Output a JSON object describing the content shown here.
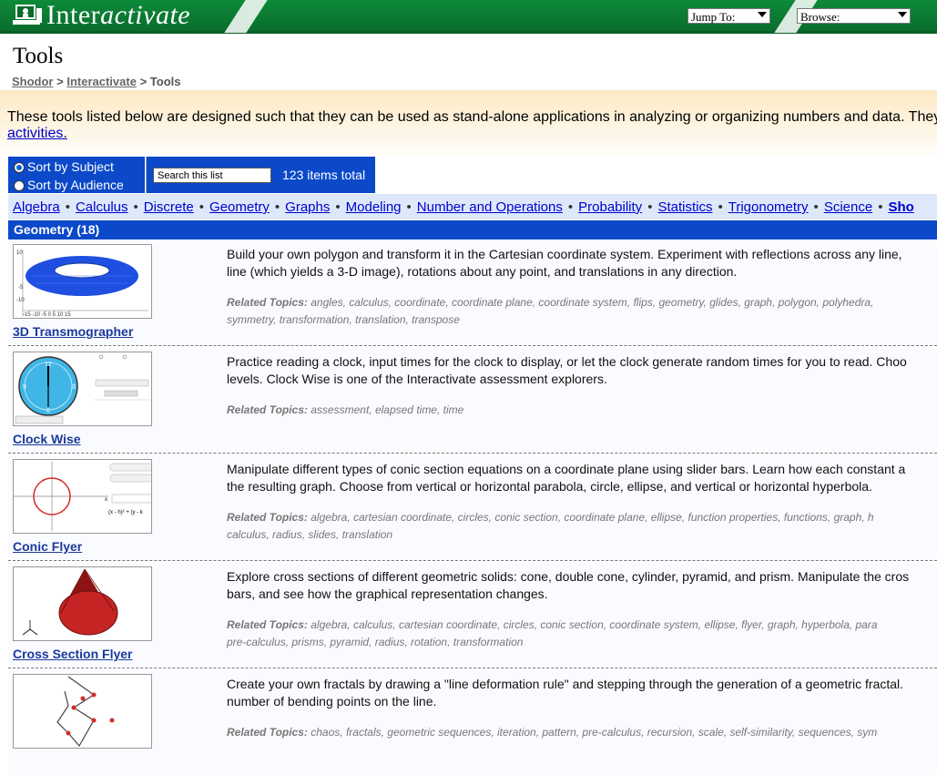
{
  "header": {
    "logo_text_bold": "Inter",
    "logo_text_italic": "activate",
    "jump_label": "Jump To:",
    "browse_label": "Browse:"
  },
  "page": {
    "title": "Tools",
    "breadcrumb": [
      {
        "label": "Shodor",
        "link": true
      },
      {
        "label": "Interactivate",
        "link": true
      },
      {
        "label": "Tools",
        "link": false
      }
    ],
    "intro_text": "These tools listed below are designed such that they can be used as stand-alone applications in analyzing or organizing numbers and data. They",
    "intro_link": "activities",
    "intro_tail": "."
  },
  "controls": {
    "sort_subject": "Sort by Subject",
    "sort_audience": "Sort by Audience",
    "search_value": "Search this list",
    "count": "123 items total"
  },
  "subjects": [
    "Algebra",
    "Calculus",
    "Discrete",
    "Geometry",
    "Graphs",
    "Modeling",
    "Number and Operations",
    "Probability",
    "Statistics",
    "Trigonometry",
    "Science",
    "Sho"
  ],
  "section": {
    "title": "Geometry  (18)"
  },
  "items": [
    {
      "name": "3D Transmographer",
      "desc1": "Build your own polygon and transform it in the Cartesian coordinate system. Experiment with reflections across any line,",
      "desc2": "line (which yields a 3-D image), rotations about any point, and translations in any direction.",
      "topics_label": "Related Topics:",
      "topics1": "angles, calculus, coordinate, coordinate plane, coordinate system, flips, geometry, glides, graph, polygon, polyhedra,",
      "topics2": "symmetry, transformation, translation, transpose",
      "thumb": "torus-graph"
    },
    {
      "name": "Clock Wise",
      "desc1": "Practice reading a clock, input times for the clock to display, or let the clock generate random times for you to read. Choo",
      "desc2": "levels. Clock Wise is one of the Interactivate assessment explorers.",
      "topics_label": "Related Topics:",
      "topics1": "assessment, elapsed time, time",
      "topics2": "",
      "thumb": "clock"
    },
    {
      "name": "Conic Flyer",
      "desc1": "Manipulate different types of conic section equations on a coordinate plane using slider bars. Learn how each constant a",
      "desc2": "the resulting graph. Choose from vertical or horizontal parabola, circle, ellipse, and vertical or horizontal hyperbola.",
      "topics_label": "Related Topics:",
      "topics1": "algebra, cartesian coordinate, circles, conic section, coordinate plane, ellipse, function properties, functions, graph, h",
      "topics2": "calculus, radius, slides, translation",
      "thumb": "circle-graph"
    },
    {
      "name": "Cross Section Flyer",
      "desc1": "Explore cross sections of different geometric solids: cone, double cone, cylinder, pyramid, and prism. Manipulate the cros",
      "desc2": "bars, and see how the graphical representation changes.",
      "topics_label": "Related Topics:",
      "topics1": "algebra, calculus, cartesian coordinate, circles, conic section, coordinate system, ellipse, flyer, graph, hyperbola, para",
      "topics2": "pre-calculus, prisms, pyramid, radius, rotation, transformation",
      "thumb": "cone"
    },
    {
      "name": "",
      "desc1": "Create your own fractals by drawing a \"line deformation rule\" and stepping through the generation of a geometric fractal.",
      "desc2": "number of bending points on the line.",
      "topics_label": "Related Topics:",
      "topics1": "chaos, fractals, geometric sequences, iteration, pattern, pre-calculus, recursion, scale, self-similarity, sequences, sym",
      "topics2": "",
      "thumb": "fractal"
    }
  ],
  "colors": {
    "header_green": "#0d8a3a",
    "nav_blue": "#0b49c9",
    "link_blue": "#0000cc"
  }
}
